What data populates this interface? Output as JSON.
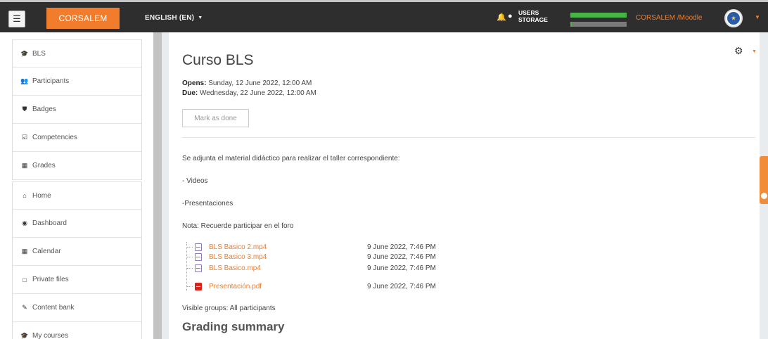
{
  "navbar": {
    "menu_icon": "hamburger-icon",
    "brand": "CORSALEM",
    "language": "ENGLISH (EN)",
    "notifications_icon": "bell-icon",
    "messages_icon": "chat-icon",
    "usage_labels": [
      "USERS",
      "STORAGE"
    ],
    "usage_levels": [
      1.0,
      0.02
    ],
    "user_name": "CORSALEM /Moodle",
    "avatar_icon": "corsalem-logo"
  },
  "drawer": {
    "course_nav": [
      {
        "label": "BLS",
        "icon": "graduation-cap-icon"
      },
      {
        "label": "Participants",
        "icon": "users-icon"
      },
      {
        "label": "Badges",
        "icon": "shield-icon"
      },
      {
        "label": "Competencies",
        "icon": "check-square-icon"
      },
      {
        "label": "Grades",
        "icon": "table-icon"
      }
    ],
    "site_nav": [
      {
        "label": "Home",
        "icon": "home-icon"
      },
      {
        "label": "Dashboard",
        "icon": "dashboard-icon"
      },
      {
        "label": "Calendar",
        "icon": "calendar-icon"
      },
      {
        "label": "Private files",
        "icon": "file-icon"
      },
      {
        "label": "Content bank",
        "icon": "brush-icon"
      },
      {
        "label": "My courses",
        "icon": "graduation-cap-icon"
      }
    ]
  },
  "main": {
    "title": "Curso BLS",
    "opens_label": "Opens:",
    "opens_value": " Sunday, 12 June 2022, 12:00 AM",
    "due_label": "Due:",
    "due_value": " Wednesday, 22 June 2022, 12:00 AM",
    "mark_done": "Mark as done",
    "description": [
      "Se adjunta el material didáctico para realizar el taller correspondiente:",
      "- Videos",
      "-Presentaciones",
      "Nota: Recuerde participar en el foro"
    ],
    "files": [
      {
        "name": "BLS Basico 2.mp4",
        "date": "9 June 2022, 7:46 PM",
        "type": "video"
      },
      {
        "name": "BLS Basico 3.mp4",
        "date": "9 June 2022, 7:46 PM",
        "type": "video"
      },
      {
        "name": "BLS Basico.mp4",
        "date": "9 June 2022, 7:46 PM",
        "type": "video"
      },
      {
        "name": "Presentación.pdf",
        "date": "9 June 2022, 7:46 PM",
        "type": "pdf"
      }
    ],
    "visible_groups": "Visible groups: All participants",
    "grading_heading": "Grading summary"
  },
  "colors": {
    "brand": "#f07c2c",
    "navbar": "#2e2e2e",
    "usage_fill": "#46b446"
  }
}
